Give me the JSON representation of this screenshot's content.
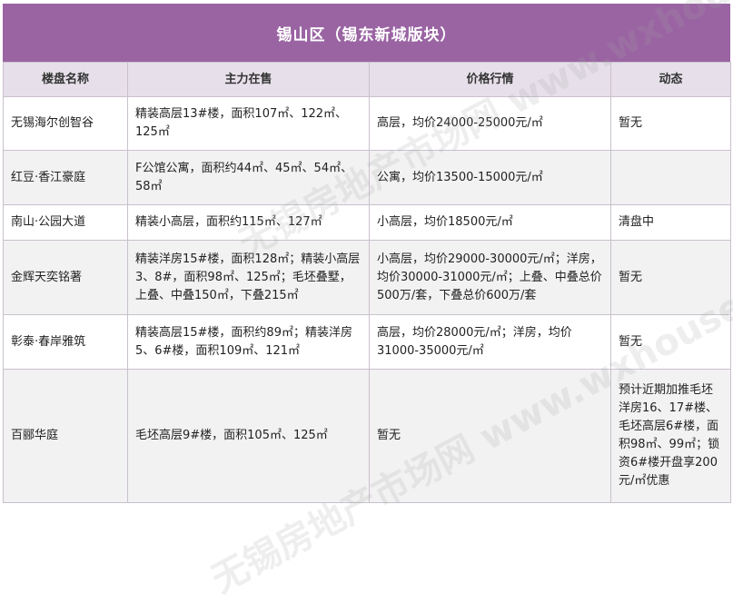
{
  "title": "锡山区（锡东新城版块）",
  "headers": [
    "楼盘名称",
    "主力在售",
    "价格行情",
    "动态"
  ],
  "rows": [
    [
      "无锡海尔创智谷",
      "精装高层13#楼，面积107㎡、122㎡、125㎡",
      "高层，均价24000-25000元/㎡",
      "暂无"
    ],
    [
      "红豆·香江豪庭",
      "F公馆公寓，面积约44㎡、45㎡、54㎡、58㎡",
      "公寓，均价13500-15000元/㎡",
      ""
    ],
    [
      "南山·公园大道",
      "精装小高层，面积约115㎡、127㎡",
      "小高层，均价18500元/㎡",
      "清盘中"
    ],
    [
      "金辉天奕铭著",
      "精装洋房15#楼，面积128㎡；精装小高层3、8#，面积98㎡、125㎡；毛坯叠墅，上叠、中叠150㎡，下叠215㎡",
      "小高层，均价29000-30000元/㎡；洋房，均价30000-31000元/㎡；上叠、中叠总价500万/套，下叠总价600万/套",
      "暂无"
    ],
    [
      "彰泰·春岸雅筑",
      "精装高层15#楼，面积约89㎡；精装洋房5、6#楼，面积109㎡、121㎡",
      "高层，均价28000元/㎡；洋房，均价31000-35000元/㎡",
      "暂无"
    ],
    [
      "百郦华庭",
      "毛坯高层9#楼，面积105㎡、125㎡",
      "暂无",
      "预计近期加推毛坯洋房16、17#楼、毛坯高层6#楼，面积98㎡、99㎡；锁资6#楼开盘享200元/㎡优惠"
    ]
  ],
  "watermark": "无锡房地产市场网 www.wxhouse.com"
}
